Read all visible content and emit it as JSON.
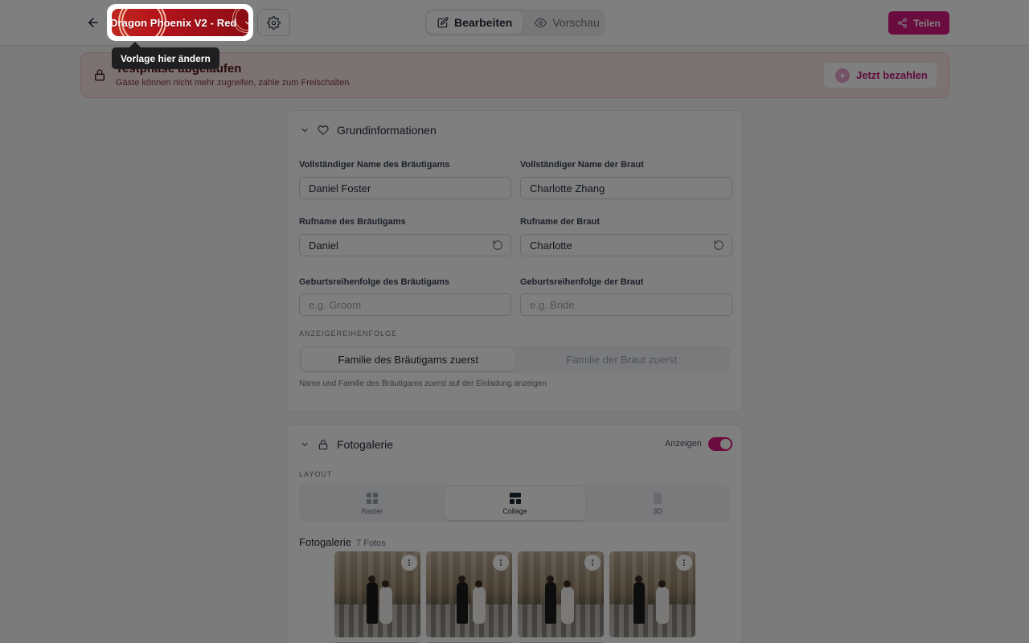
{
  "header": {
    "template_name": "Dragon Phoenix V2 - Red",
    "tabs": [
      {
        "label": "Bearbeiten",
        "active": true
      },
      {
        "label": "Vorschau",
        "active": false
      }
    ],
    "share_label": "Teilen",
    "accent_color": "#d6187e"
  },
  "tooltip": "Vorlage hier ändern",
  "banner": {
    "title": "Testphase abgelaufen",
    "subtitle": "Gäste können nicht mehr zugreifen, zahle zum Freischalten",
    "pay_label": "Jetzt bezahlen"
  },
  "basic_info": {
    "title": "Grundinformationen",
    "groom_full_label": "Vollständiger Name des Bräutigams",
    "groom_full_value": "Daniel Foster",
    "bride_full_label": "Vollständiger Name der Braut",
    "bride_full_value": "Charlotte Zhang",
    "groom_nick_label": "Rufname des Bräutigams",
    "groom_nick_value": "Daniel",
    "bride_nick_label": "Rufname der Braut",
    "bride_nick_value": "Charlotte",
    "groom_order_label": "Geburtsreihenfolge des Bräutigams",
    "groom_order_placeholder": "e.g. Groom",
    "bride_order_label": "Geburtsreihenfolge der Braut",
    "bride_order_placeholder": "e.g. Bride",
    "display_order_caption": "Anzeigereihenfolge",
    "display_order_options": [
      "Familie des Bräutigams zuerst",
      "Familie der Braut zuerst"
    ],
    "display_order_selected": "Familie des Bräutigams zuerst",
    "display_order_hint": "Name und Familie des Bräutigams zuerst auf der Einladung anzeigen"
  },
  "gallery": {
    "title": "Fotogalerie",
    "show_label": "Anzeigen",
    "show_enabled": true,
    "layout_caption": "Layout",
    "layout_options": [
      {
        "label": "Raster",
        "icon": "grid-icon"
      },
      {
        "label": "Collage",
        "icon": "collage-icon"
      },
      {
        "label": "3D",
        "icon": "cube-icon"
      }
    ],
    "layout_selected": "Collage",
    "photos_label": "Fotogalerie",
    "photos_count": "7 Fotos"
  }
}
